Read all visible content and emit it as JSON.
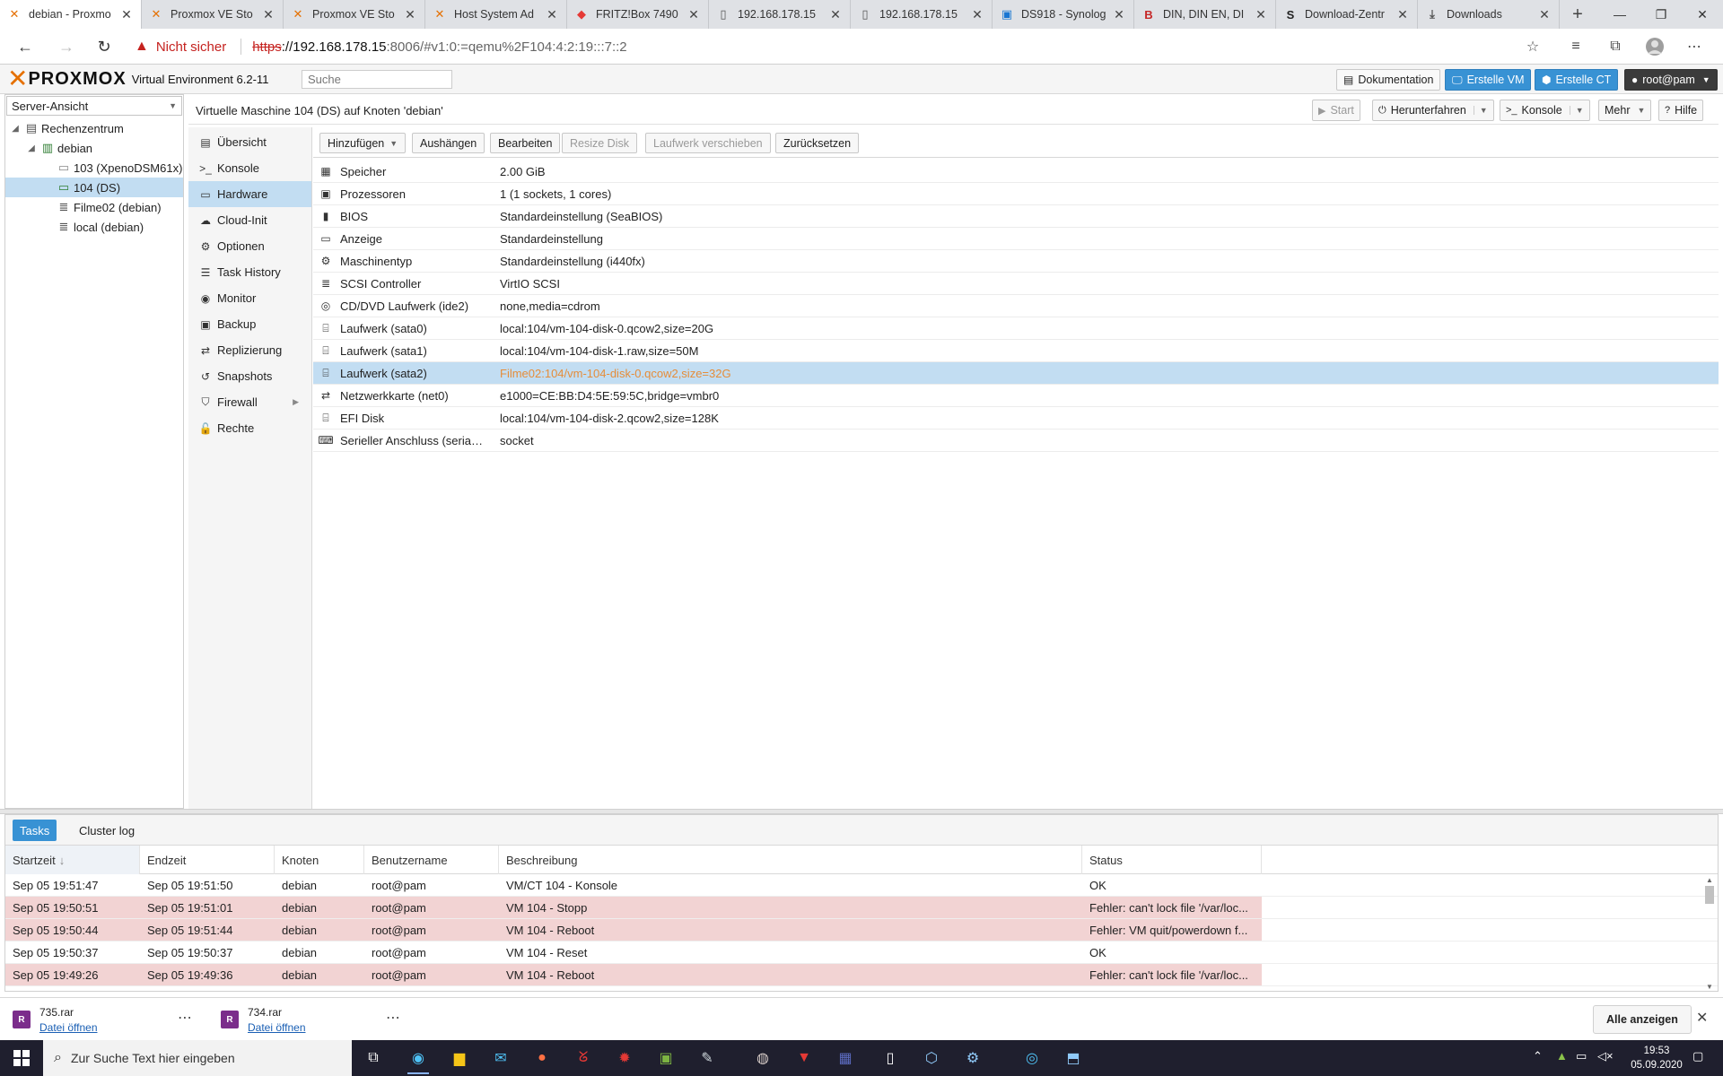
{
  "browser": {
    "tabs": [
      {
        "title": "debian - Proxmo",
        "icon": "proxmox-icon",
        "active": true
      },
      {
        "title": "Proxmox VE Sto",
        "icon": "proxmox-icon"
      },
      {
        "title": "Proxmox VE Sto",
        "icon": "proxmox-icon"
      },
      {
        "title": "Host System Ad",
        "icon": "proxmox-icon"
      },
      {
        "title": "FRITZ!Box 7490",
        "icon": "fritzbox-icon"
      },
      {
        "title": "192.168.178.15",
        "icon": "document-icon"
      },
      {
        "title": "192.168.178.15",
        "icon": "document-icon"
      },
      {
        "title": "DS918 - Synolog",
        "icon": "synology-icon"
      },
      {
        "title": "DIN, DIN EN, DI",
        "icon": "beuth-icon"
      },
      {
        "title": "Download-Zentr",
        "icon": "download-center-icon"
      },
      {
        "title": "Downloads",
        "icon": "download-icon"
      }
    ],
    "security_label": "Nicht sicher",
    "url_scheme": "https",
    "url_host": "://192.168.178.15",
    "url_rest": ":8006/#v1:0:=qemu%2F104:4:2:19:::7::2"
  },
  "pve": {
    "version": "Virtual Environment 6.2-11",
    "search_placeholder": "Suche",
    "buttons": {
      "docs": "Dokumentation",
      "create_vm": "Erstelle VM",
      "create_ct": "Erstelle CT",
      "user": "root@pam"
    },
    "view_selector": "Server-Ansicht",
    "tree": [
      {
        "label": "Rechenzentrum",
        "level": 0,
        "icon": "datacenter-icon"
      },
      {
        "label": "debian",
        "level": 1,
        "icon": "node-icon"
      },
      {
        "label": "103 (XpenoDSM61x)",
        "level": 2,
        "icon": "vm-stopped-icon"
      },
      {
        "label": "104 (DS)",
        "level": 2,
        "icon": "vm-running-icon",
        "selected": true
      },
      {
        "label": "Filme02 (debian)",
        "level": 2,
        "icon": "storage-icon"
      },
      {
        "label": "local (debian)",
        "level": 2,
        "icon": "storage-icon"
      }
    ],
    "vm_title": "Virtuelle Maschine 104 (DS) auf Knoten 'debian'",
    "vm_buttons": {
      "start": "Start",
      "shutdown": "Herunterfahren",
      "console": "Konsole",
      "more": "Mehr",
      "help": "Hilfe"
    },
    "nav": [
      {
        "label": "Übersicht",
        "icon": "summary-icon"
      },
      {
        "label": "Konsole",
        "icon": "terminal-icon"
      },
      {
        "label": "Hardware",
        "icon": "desktop-icon",
        "selected": true
      },
      {
        "label": "Cloud-Init",
        "icon": "cloud-icon"
      },
      {
        "label": "Optionen",
        "icon": "gear-icon"
      },
      {
        "label": "Task History",
        "icon": "list-icon"
      },
      {
        "label": "Monitor",
        "icon": "eye-icon"
      },
      {
        "label": "Backup",
        "icon": "floppy-icon"
      },
      {
        "label": "Replizierung",
        "icon": "retweet-icon"
      },
      {
        "label": "Snapshots",
        "icon": "history-icon"
      },
      {
        "label": "Firewall",
        "icon": "shield-icon",
        "has_submenu": true
      },
      {
        "label": "Rechte",
        "icon": "unlock-icon"
      }
    ],
    "hw_toolbar": {
      "add": "Hinzufügen",
      "detach": "Aushängen",
      "edit": "Bearbeiten",
      "resize": "Resize Disk",
      "move": "Laufwerk verschieben",
      "revert": "Zurücksetzen"
    },
    "hardware": [
      {
        "key": "Speicher",
        "value": "2.00 GiB",
        "icon": "memory-icon"
      },
      {
        "key": "Prozessoren",
        "value": "1 (1 sockets, 1 cores)",
        "icon": "cpu-icon"
      },
      {
        "key": "BIOS",
        "value": "Standardeinstellung (SeaBIOS)",
        "icon": "microchip-icon"
      },
      {
        "key": "Anzeige",
        "value": "Standardeinstellung",
        "icon": "display-icon"
      },
      {
        "key": "Maschinentyp",
        "value": "Standardeinstellung (i440fx)",
        "icon": "cogs-icon"
      },
      {
        "key": "SCSI Controller",
        "value": "VirtIO SCSI",
        "icon": "database-icon"
      },
      {
        "key": "CD/DVD Laufwerk (ide2)",
        "value": "none,media=cdrom",
        "icon": "cdrom-icon"
      },
      {
        "key": "Laufwerk (sata0)",
        "value": "local:104/vm-104-disk-0.qcow2,size=20G",
        "icon": "hdd-icon"
      },
      {
        "key": "Laufwerk (sata1)",
        "value": "local:104/vm-104-disk-1.raw,size=50M",
        "icon": "hdd-icon"
      },
      {
        "key": "Laufwerk (sata2)",
        "value": "Filme02:104/vm-104-disk-0.qcow2,size=32G",
        "icon": "hdd-icon",
        "selected": true
      },
      {
        "key": "Netzwerkkarte (net0)",
        "value": "e1000=CE:BB:D4:5E:59:5C,bridge=vmbr0",
        "icon": "exchange-icon"
      },
      {
        "key": "EFI Disk",
        "value": "local:104/vm-104-disk-2.qcow2,size=128K",
        "icon": "hdd-icon"
      },
      {
        "key": "Serieller Anschluss (seria…",
        "value": "socket",
        "icon": "keyboard-icon"
      }
    ],
    "tasks_tabs": {
      "tasks": "Tasks",
      "cluster_log": "Cluster log"
    },
    "task_columns": [
      "Startzeit",
      "Endzeit",
      "Knoten",
      "Benutzername",
      "Beschreibung",
      "Status"
    ],
    "tasks": [
      {
        "start": "Sep 05 19:51:47",
        "end": "Sep 05 19:51:50",
        "node": "debian",
        "user": "root@pam",
        "desc": "VM/CT 104 - Konsole",
        "status": "OK",
        "error": false
      },
      {
        "start": "Sep 05 19:50:51",
        "end": "Sep 05 19:51:01",
        "node": "debian",
        "user": "root@pam",
        "desc": "VM 104 - Stopp",
        "status": "Fehler: can't lock file '/var/loc...",
        "error": true
      },
      {
        "start": "Sep 05 19:50:44",
        "end": "Sep 05 19:51:44",
        "node": "debian",
        "user": "root@pam",
        "desc": "VM 104 - Reboot",
        "status": "Fehler: VM quit/powerdown f...",
        "error": true
      },
      {
        "start": "Sep 05 19:50:37",
        "end": "Sep 05 19:50:37",
        "node": "debian",
        "user": "root@pam",
        "desc": "VM 104 - Reset",
        "status": "OK",
        "error": false
      },
      {
        "start": "Sep 05 19:49:26",
        "end": "Sep 05 19:49:36",
        "node": "debian",
        "user": "root@pam",
        "desc": "VM 104 - Reboot",
        "status": "Fehler: can't lock file '/var/loc...",
        "error": true
      }
    ]
  },
  "downloads": {
    "items": [
      {
        "name": "735.rar",
        "action": "Datei öffnen"
      },
      {
        "name": "734.rar",
        "action": "Datei öffnen"
      }
    ],
    "show_all": "Alle anzeigen"
  },
  "taskbar": {
    "search_placeholder": "Zur Suche Text hier eingeben",
    "time": "19:53",
    "date": "05.09.2020"
  },
  "colors": {
    "proxmox_orange": "#e57000",
    "selection_blue": "#c2ddf2",
    "button_blue": "#3892d4",
    "error_row": "#f2d3d3",
    "selected_value": "#e58d3a"
  }
}
